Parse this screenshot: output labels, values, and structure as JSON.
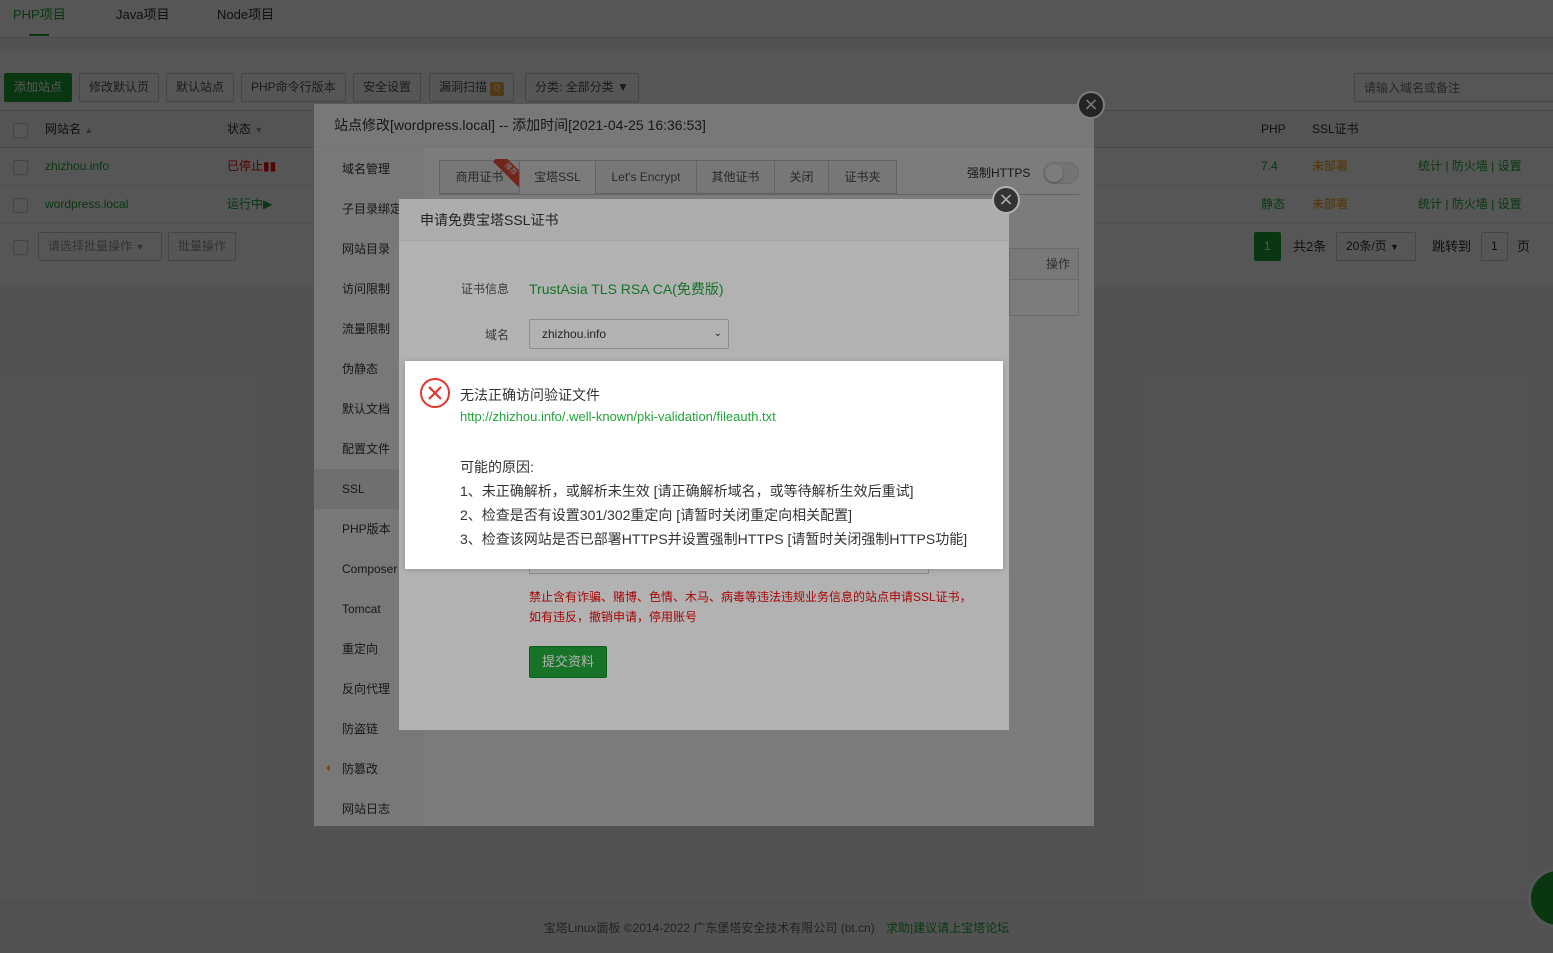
{
  "top_tabs": [
    "PHP项目",
    "Java项目",
    "Node项目"
  ],
  "toolbar": {
    "add_site": "添加站点",
    "edit_default_page": "修改默认页",
    "default_site": "默认站点",
    "php_cli": "PHP命令行版本",
    "security": "安全设置",
    "vuln_scan": "漏洞扫描",
    "vuln_count": "0",
    "category": "分类: 全部分类",
    "search_placeholder": "请输入域名或备注"
  },
  "table": {
    "headers": {
      "name": "网站名",
      "status": "状态",
      "php": "PHP",
      "ssl": "SSL证书"
    },
    "rows": [
      {
        "name": "zhizhou.info",
        "status": "已停止",
        "php": "7.4",
        "ssl": "未部署",
        "ops": [
          "统计",
          "防火墙",
          "设置"
        ]
      },
      {
        "name": "wordpress.local",
        "status": "运行中",
        "php": "静态",
        "ssl": "未部署",
        "ops": [
          "统计",
          "防火墙",
          "设置"
        ]
      }
    ],
    "batch_placeholder": "请选择批量操作",
    "batch_button": "批量操作"
  },
  "pagination": {
    "page": "1",
    "total": "共2条",
    "per_page": "20条/页",
    "jump_label": "跳转到",
    "jump_value": "1",
    "page_unit": "页"
  },
  "footer": {
    "copyright": "宝塔Linux面板 ©2014-2022 广东堡塔安全技术有限公司 (bt.cn)",
    "help_link": "求助|建议请上宝塔论坛"
  },
  "site_dialog": {
    "title": "站点修改[wordpress.local] -- 添加时间[2021-04-25 16:36:53]",
    "menu": [
      "域名管理",
      "子目录绑定",
      "网站目录",
      "访问限制",
      "流量限制",
      "伪静态",
      "默认文档",
      "配置文件",
      "SSL",
      "PHP版本",
      "Composer",
      "Tomcat",
      "重定向",
      "反向代理",
      "防盗链",
      "防篡改",
      "网站日志"
    ],
    "active_menu": "SSL",
    "ssl_tabs": [
      "商用证书",
      "宝塔SSL",
      "Let's Encrypt",
      "其他证书",
      "关闭",
      "证书夹"
    ],
    "ribbon_text": "推荐",
    "force_https": "强制HTTPS",
    "ops_header": "操作"
  },
  "ssl_dialog": {
    "title": "申请免费宝塔SSL证书",
    "cert_label": "证书信息",
    "cert_value": "TrustAsia TLS RSA CA(免费版)",
    "domain_label": "域名",
    "domain_value": "zhizhou.info",
    "warning_1": "禁止含有诈骗、赌博、色情、木马、病毒等违法违规业务信息的站点申请SSL证书，",
    "warning_2": "如有违反，撤销申请，停用账号",
    "submit": "提交资料"
  },
  "error_msg": {
    "title": "无法正确访问验证文件",
    "url": "http://zhizhou.info/.well-known/pki-validation/fileauth.txt",
    "reasons_title": "可能的原因:",
    "reasons": [
      "1、未正确解析，或解析未生效 [请正确解析域名，或等待解析生效后重试]",
      "2、检查是否有设置301/302重定向 [请暂时关闭重定向相关配置]",
      "3、检查该网站是否已部署HTTPS并设置强制HTTPS [请暂时关闭强制HTTPS功能]"
    ]
  },
  "colors": {
    "accent": "#20a53a",
    "danger": "#ef0808",
    "warning": "#ff9900"
  }
}
